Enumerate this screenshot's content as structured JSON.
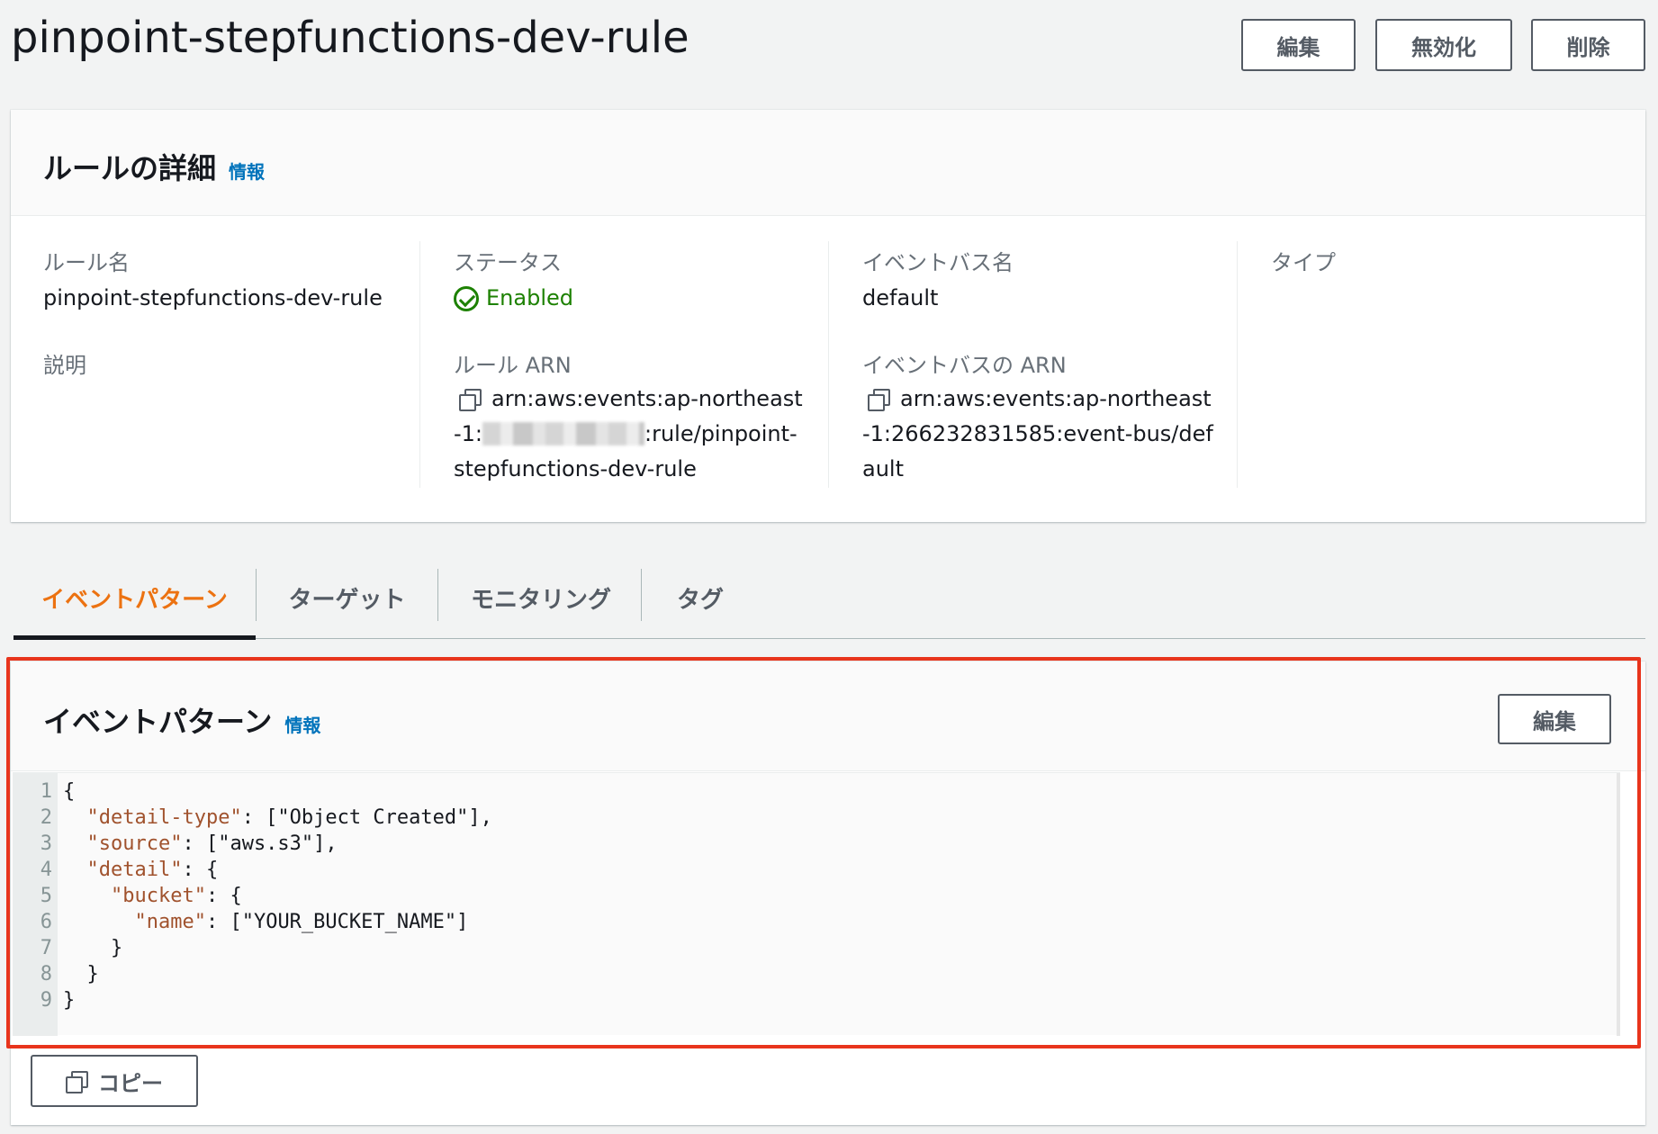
{
  "header": {
    "title": "pinpoint-stepfunctions-dev-rule",
    "buttons": {
      "edit": "編集",
      "disable": "無効化",
      "delete": "削除"
    }
  },
  "details": {
    "title": "ルールの詳細",
    "info": "情報",
    "rule_name_label": "ルール名",
    "rule_name": "pinpoint-stepfunctions-dev-rule",
    "description_label": "説明",
    "status_label": "ステータス",
    "status": "Enabled",
    "rule_arn_label": "ルール ARN",
    "rule_arn_line1": "arn:aws:events:ap-northeast",
    "rule_arn_line2_prefix": "-1:",
    "rule_arn_line2_suffix": ":rule/pinpoint-",
    "rule_arn_line3": "stepfunctions-dev-rule",
    "bus_name_label": "イベントバス名",
    "bus_name": "default",
    "bus_arn_label": "イベントバスの ARN",
    "bus_arn_line1": "arn:aws:events:ap-northeast",
    "bus_arn_line2": "-1:266232831585:event-bus/def",
    "bus_arn_line3": "ault",
    "type_label": "タイプ"
  },
  "tabs": [
    {
      "label": "イベントパターン",
      "active": true
    },
    {
      "label": "ターゲット",
      "active": false
    },
    {
      "label": "モニタリング",
      "active": false
    },
    {
      "label": "タグ",
      "active": false
    }
  ],
  "event_pattern": {
    "title": "イベントパターン",
    "info": "情報",
    "edit": "編集",
    "copy": "コピー",
    "code_lines": [
      {
        "n": "1",
        "text": "{"
      },
      {
        "n": "2",
        "key": "\"detail-type\"",
        "rest": ": [\"Object Created\"],",
        "indent": "  "
      },
      {
        "n": "3",
        "key": "\"source\"",
        "rest": ": [\"aws.s3\"],",
        "indent": "  "
      },
      {
        "n": "4",
        "key": "\"detail\"",
        "rest": ": {",
        "indent": "  "
      },
      {
        "n": "5",
        "key": "\"bucket\"",
        "rest": ": {",
        "indent": "    "
      },
      {
        "n": "6",
        "key": "\"name\"",
        "rest": ": [\"YOUR_BUCKET_NAME\"]",
        "indent": "      "
      },
      {
        "n": "7",
        "text": "    }"
      },
      {
        "n": "8",
        "text": "  }"
      },
      {
        "n": "9",
        "text": "}"
      }
    ]
  },
  "colors": {
    "accent_tab": "#ec7211",
    "status_ok": "#1d8102",
    "link": "#0073bb",
    "highlight_box": "#e8341c"
  }
}
